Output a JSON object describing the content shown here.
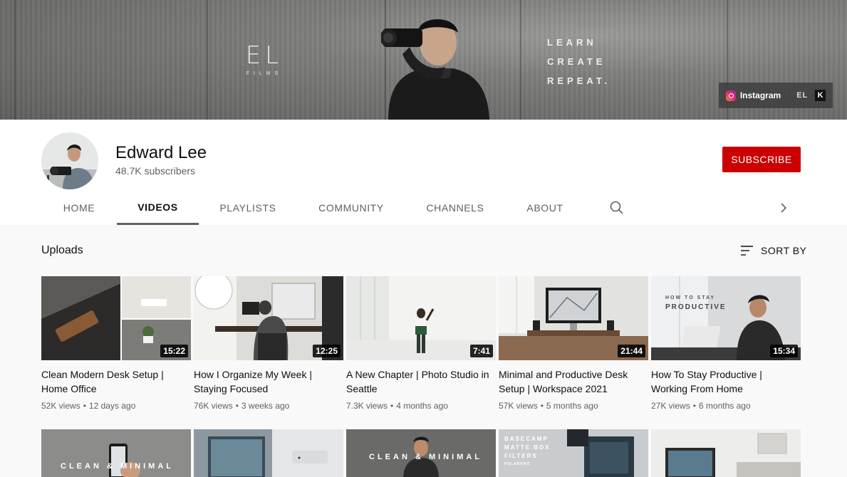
{
  "banner": {
    "logo_mark": "EL",
    "logo_sub": "FILMS",
    "tagline": [
      "LEARN",
      "CREATE",
      "REPEAT."
    ],
    "links": {
      "instagram": "Instagram",
      "el": "EL",
      "k": "K"
    }
  },
  "channel": {
    "name": "Edward Lee",
    "subscribers": "48.7K subscribers",
    "subscribe_label": "SUBSCRIBE"
  },
  "tabs": [
    {
      "label": "HOME"
    },
    {
      "label": "VIDEOS",
      "active": true
    },
    {
      "label": "PLAYLISTS"
    },
    {
      "label": "COMMUNITY"
    },
    {
      "label": "CHANNELS"
    },
    {
      "label": "ABOUT"
    }
  ],
  "section": {
    "title": "Uploads",
    "sort_label": "SORT BY"
  },
  "videos": [
    {
      "title": "Clean Modern Desk Setup | Home Office",
      "views": "52K views",
      "age": "12 days ago",
      "duration": "15:22"
    },
    {
      "title": "How I Organize My Week | Staying Focused",
      "views": "76K views",
      "age": "3 weeks ago",
      "duration": "12:25"
    },
    {
      "title": "A New Chapter | Photo Studio in Seattle",
      "views": "7.3K views",
      "age": "4 months ago",
      "duration": "7:41"
    },
    {
      "title": "Minimal and Productive Desk Setup | Workspace 2021",
      "views": "57K views",
      "age": "5 months ago",
      "duration": "21:44"
    },
    {
      "title": "How To Stay Productive | Working From Home",
      "views": "27K views",
      "age": "6 months ago",
      "duration": "15:34",
      "overlay": [
        "HOW TO STAY",
        "PRODUCTIVE"
      ]
    }
  ],
  "row2_overlays": {
    "v1": "CLEAN & MINIMAL",
    "v3": "CLEAN & MINIMAL",
    "v4": [
      "BASECAMP",
      "MATTE BOX",
      "FILTERS",
      "POLARPRO"
    ]
  },
  "colors": {
    "brand": "#cc0000",
    "text": "#0f0f0f",
    "secondary": "#606060"
  }
}
